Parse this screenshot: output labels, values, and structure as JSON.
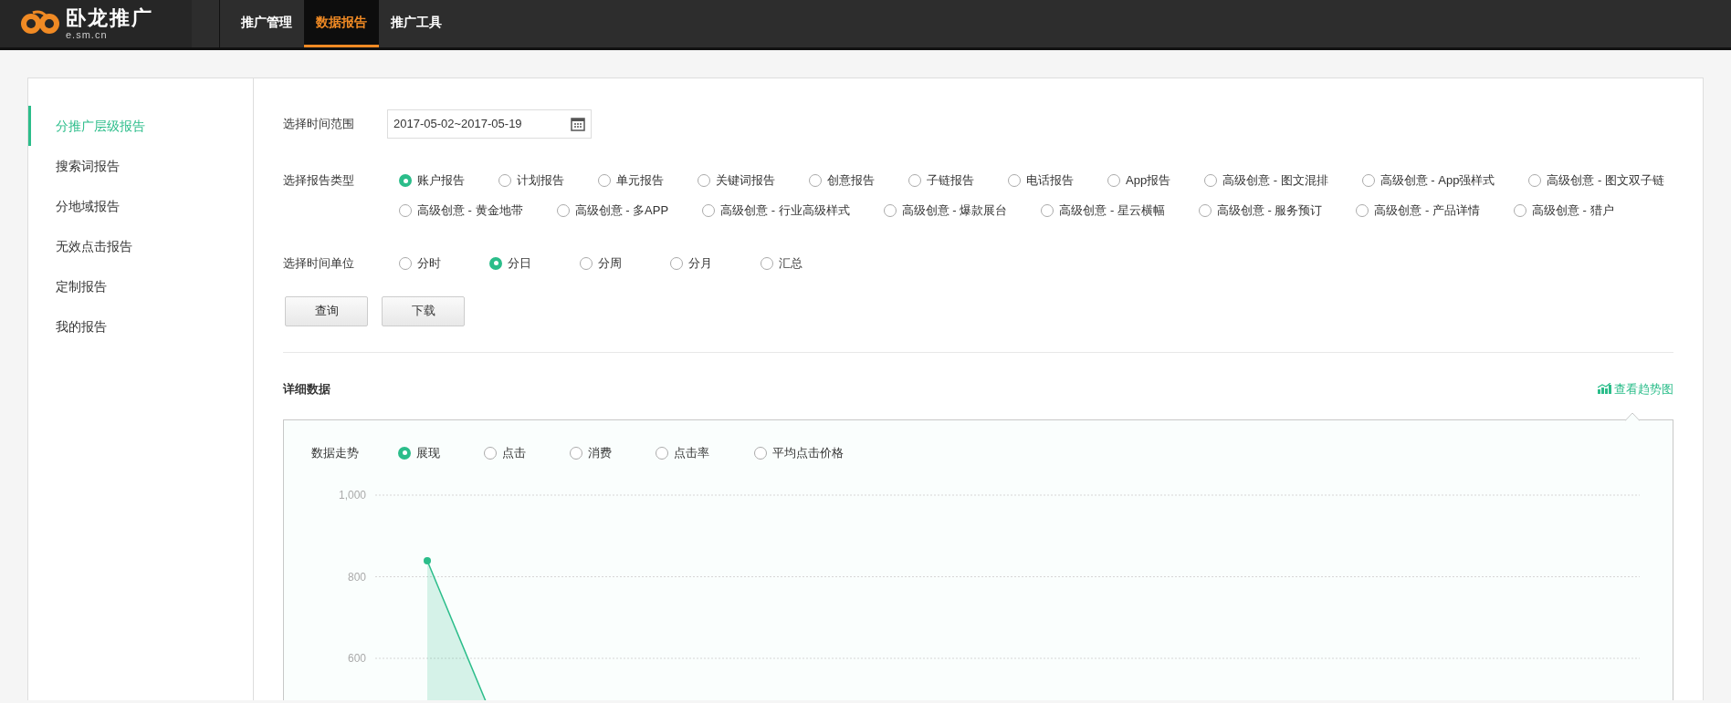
{
  "logo": {
    "name": "卧龙推广",
    "domain": "e.sm.cn"
  },
  "nav": [
    {
      "label": "推广管理",
      "selected": false
    },
    {
      "label": "数据报告",
      "selected": true
    },
    {
      "label": "推广工具",
      "selected": false
    }
  ],
  "sidebar": {
    "items": [
      {
        "label": "分推广层级报告",
        "selected": true
      },
      {
        "label": "搜索词报告",
        "selected": false
      },
      {
        "label": "分地域报告",
        "selected": false
      },
      {
        "label": "无效点击报告",
        "selected": false
      },
      {
        "label": "定制报告",
        "selected": false
      },
      {
        "label": "我的报告",
        "selected": false
      }
    ]
  },
  "filters": {
    "date_range": {
      "label": "选择时间范围",
      "value": "2017-05-02~2017-05-19"
    },
    "report_type": {
      "label": "选择报告类型",
      "options": [
        {
          "label": "账户报告",
          "selected": true
        },
        {
          "label": "计划报告",
          "selected": false
        },
        {
          "label": "单元报告",
          "selected": false
        },
        {
          "label": "关键词报告",
          "selected": false
        },
        {
          "label": "创意报告",
          "selected": false
        },
        {
          "label": "子链报告",
          "selected": false
        },
        {
          "label": "电话报告",
          "selected": false
        },
        {
          "label": "App报告",
          "selected": false
        },
        {
          "label": "高级创意 - 图文混排",
          "selected": false
        },
        {
          "label": "高级创意 - App强样式",
          "selected": false
        },
        {
          "label": "高级创意 - 图文双子链",
          "selected": false
        },
        {
          "label": "高级创意 - 黄金地带",
          "selected": false
        },
        {
          "label": "高级创意 - 多APP",
          "selected": false
        },
        {
          "label": "高级创意 - 行业高级样式",
          "selected": false
        },
        {
          "label": "高级创意 - 爆款展台",
          "selected": false
        },
        {
          "label": "高级创意 - 星云横幅",
          "selected": false
        },
        {
          "label": "高级创意 - 服务预订",
          "selected": false
        },
        {
          "label": "高级创意 - 产品详情",
          "selected": false
        },
        {
          "label": "高级创意 - 猎户",
          "selected": false
        }
      ]
    },
    "time_unit": {
      "label": "选择时间单位",
      "options": [
        {
          "label": "分时",
          "selected": false
        },
        {
          "label": "分日",
          "selected": true
        },
        {
          "label": "分周",
          "selected": false
        },
        {
          "label": "分月",
          "selected": false
        },
        {
          "label": "汇总",
          "selected": false
        }
      ]
    },
    "buttons": [
      "查询",
      "下载"
    ]
  },
  "details": {
    "title": "详细数据",
    "trend_link": "查看趋势图",
    "trend": {
      "label": "数据走势",
      "options": [
        {
          "label": "展现",
          "selected": true
        },
        {
          "label": "点击",
          "selected": false
        },
        {
          "label": "消费",
          "selected": false
        },
        {
          "label": "点击率",
          "selected": false
        },
        {
          "label": "平均点击价格",
          "selected": false
        }
      ],
      "y_axis_labels": [
        "1,000",
        "800",
        "600"
      ]
    }
  }
}
